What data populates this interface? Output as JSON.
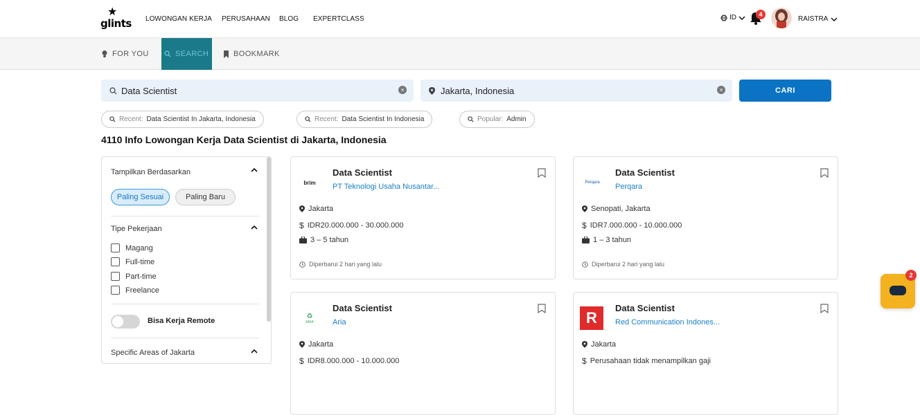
{
  "brand": {
    "logo_text": "glints"
  },
  "nav": {
    "links": [
      "LOWONGAN KERJA",
      "PERUSAHAAN",
      "BLOG",
      "EXPERTCLASS"
    ],
    "lang": "ID",
    "notif_count": "4",
    "user_name": "RAISTRA"
  },
  "subnav": {
    "tabs": [
      {
        "label": "FOR YOU",
        "icon": "lightbulb-icon"
      },
      {
        "label": "SEARCH",
        "icon": "search-icon"
      },
      {
        "label": "BOOKMARK",
        "icon": "bookmark-icon"
      }
    ]
  },
  "search": {
    "query": "Data Scientist",
    "location": "Jakarta, Indonesia",
    "button": "CARI"
  },
  "chips": [
    {
      "prefix": "Recent:",
      "text": "Data Scientist In Jakarta, Indonesia"
    },
    {
      "prefix": "Recent:",
      "text": "Data Scientist In Indonesia"
    },
    {
      "prefix": "Popular:",
      "text": "Admin"
    }
  ],
  "result_heading": "4110 Info Lowongan Kerja Data Scientist di Jakarta, Indonesia",
  "sidebar": {
    "sort_heading": "Tampilkan Berdasarkan",
    "sort_options": [
      "Paling Sesuai",
      "Paling Baru"
    ],
    "type_heading": "Tipe Pekerjaan",
    "types": [
      "Magang",
      "Full-time",
      "Part-time",
      "Freelance"
    ],
    "remote_label": "Bisa Kerja Remote",
    "area_heading": "Specific Areas of Jakarta"
  },
  "jobs": [
    {
      "title": "Data Scientist",
      "company": "PT Teknologi Usaha Nusantar...",
      "logo": "brim",
      "location": "Jakarta",
      "salary": "IDR20.000.000 - 30.000.000",
      "experience": "3 – 5 tahun",
      "updated": "Diperbarui 2 hari yang lalu"
    },
    {
      "title": "Data Scientist",
      "company": "Perqara",
      "logo": "Perqara",
      "location": "Senopati, Jakarta",
      "salary": "IDR7.000.000 - 10.000.000",
      "experience": "1 – 3 tahun",
      "updated": "Diperbarui 2 hari yang lalu"
    },
    {
      "title": "Data Scientist",
      "company": "Aria",
      "logo": "ARIA",
      "location": "Jakarta",
      "salary": "IDR8.000.000 - 10.000.000"
    },
    {
      "title": "Data Scientist",
      "company": "Red Communication Indones...",
      "logo": "R",
      "location": "Jakarta",
      "salary": "Perusahaan tidak menampilkan gaji"
    }
  ],
  "chat": {
    "badge": "2"
  },
  "colors": {
    "primary": "#0b73c4",
    "chat": "#f4b120",
    "badge": "#e53935"
  }
}
